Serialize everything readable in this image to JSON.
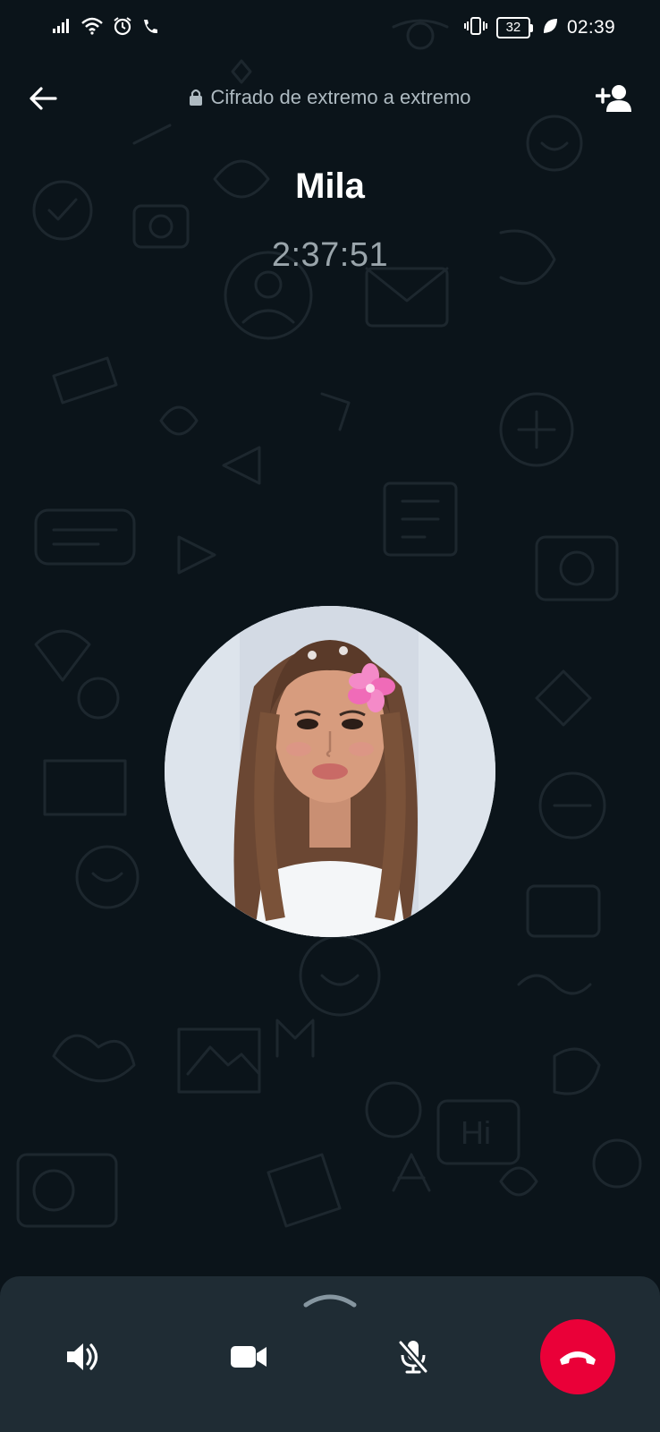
{
  "status_bar": {
    "time": "02:39",
    "battery_level": "32",
    "left_icons": [
      "signal-icon",
      "wifi-icon",
      "alarm-icon",
      "phone-icon"
    ],
    "right_icons": [
      "vibrate-icon",
      "battery-icon",
      "power-saving-leaf-icon"
    ]
  },
  "header": {
    "back_icon": "arrow-left-icon",
    "encryption_text": "Cifrado de extremo a extremo",
    "lock_icon": "lock-icon",
    "add_participant_icon": "add-person-icon"
  },
  "call": {
    "contact_name": "Mila",
    "duration": "2:37:51"
  },
  "controls": {
    "handle_icon": "chevron-up-icon",
    "speaker_icon": "speaker-icon",
    "video_icon": "video-camera-icon",
    "mute_icon": "microphone-off-icon",
    "end_call_icon": "end-call-icon"
  },
  "colors": {
    "background": "#0b141a",
    "control_sheet": "#1f2c34",
    "end_call": "#ea0038",
    "muted_text": "#aebac1"
  }
}
